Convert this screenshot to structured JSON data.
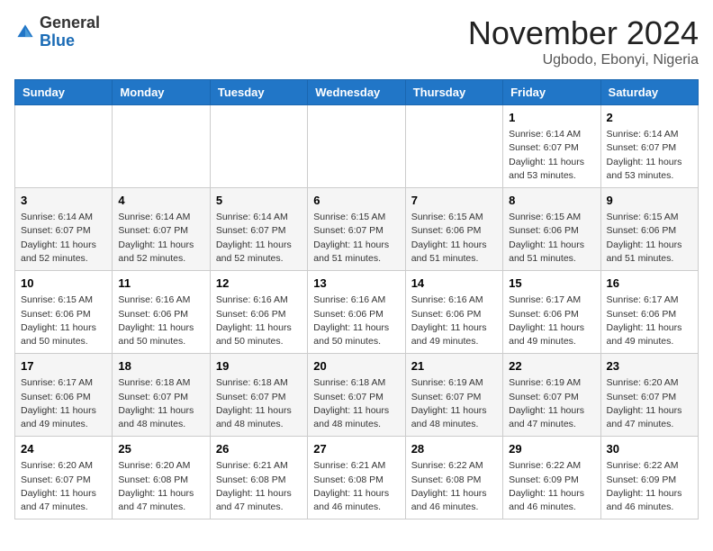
{
  "header": {
    "logo_general": "General",
    "logo_blue": "Blue",
    "month_title": "November 2024",
    "location": "Ugbodo, Ebonyi, Nigeria"
  },
  "days_of_week": [
    "Sunday",
    "Monday",
    "Tuesday",
    "Wednesday",
    "Thursday",
    "Friday",
    "Saturday"
  ],
  "weeks": [
    [
      {
        "day": "",
        "info": ""
      },
      {
        "day": "",
        "info": ""
      },
      {
        "day": "",
        "info": ""
      },
      {
        "day": "",
        "info": ""
      },
      {
        "day": "",
        "info": ""
      },
      {
        "day": "1",
        "info": "Sunrise: 6:14 AM\nSunset: 6:07 PM\nDaylight: 11 hours\nand 53 minutes."
      },
      {
        "day": "2",
        "info": "Sunrise: 6:14 AM\nSunset: 6:07 PM\nDaylight: 11 hours\nand 53 minutes."
      }
    ],
    [
      {
        "day": "3",
        "info": "Sunrise: 6:14 AM\nSunset: 6:07 PM\nDaylight: 11 hours\nand 52 minutes."
      },
      {
        "day": "4",
        "info": "Sunrise: 6:14 AM\nSunset: 6:07 PM\nDaylight: 11 hours\nand 52 minutes."
      },
      {
        "day": "5",
        "info": "Sunrise: 6:14 AM\nSunset: 6:07 PM\nDaylight: 11 hours\nand 52 minutes."
      },
      {
        "day": "6",
        "info": "Sunrise: 6:15 AM\nSunset: 6:07 PM\nDaylight: 11 hours\nand 51 minutes."
      },
      {
        "day": "7",
        "info": "Sunrise: 6:15 AM\nSunset: 6:06 PM\nDaylight: 11 hours\nand 51 minutes."
      },
      {
        "day": "8",
        "info": "Sunrise: 6:15 AM\nSunset: 6:06 PM\nDaylight: 11 hours\nand 51 minutes."
      },
      {
        "day": "9",
        "info": "Sunrise: 6:15 AM\nSunset: 6:06 PM\nDaylight: 11 hours\nand 51 minutes."
      }
    ],
    [
      {
        "day": "10",
        "info": "Sunrise: 6:15 AM\nSunset: 6:06 PM\nDaylight: 11 hours\nand 50 minutes."
      },
      {
        "day": "11",
        "info": "Sunrise: 6:16 AM\nSunset: 6:06 PM\nDaylight: 11 hours\nand 50 minutes."
      },
      {
        "day": "12",
        "info": "Sunrise: 6:16 AM\nSunset: 6:06 PM\nDaylight: 11 hours\nand 50 minutes."
      },
      {
        "day": "13",
        "info": "Sunrise: 6:16 AM\nSunset: 6:06 PM\nDaylight: 11 hours\nand 50 minutes."
      },
      {
        "day": "14",
        "info": "Sunrise: 6:16 AM\nSunset: 6:06 PM\nDaylight: 11 hours\nand 49 minutes."
      },
      {
        "day": "15",
        "info": "Sunrise: 6:17 AM\nSunset: 6:06 PM\nDaylight: 11 hours\nand 49 minutes."
      },
      {
        "day": "16",
        "info": "Sunrise: 6:17 AM\nSunset: 6:06 PM\nDaylight: 11 hours\nand 49 minutes."
      }
    ],
    [
      {
        "day": "17",
        "info": "Sunrise: 6:17 AM\nSunset: 6:06 PM\nDaylight: 11 hours\nand 49 minutes."
      },
      {
        "day": "18",
        "info": "Sunrise: 6:18 AM\nSunset: 6:07 PM\nDaylight: 11 hours\nand 48 minutes."
      },
      {
        "day": "19",
        "info": "Sunrise: 6:18 AM\nSunset: 6:07 PM\nDaylight: 11 hours\nand 48 minutes."
      },
      {
        "day": "20",
        "info": "Sunrise: 6:18 AM\nSunset: 6:07 PM\nDaylight: 11 hours\nand 48 minutes."
      },
      {
        "day": "21",
        "info": "Sunrise: 6:19 AM\nSunset: 6:07 PM\nDaylight: 11 hours\nand 48 minutes."
      },
      {
        "day": "22",
        "info": "Sunrise: 6:19 AM\nSunset: 6:07 PM\nDaylight: 11 hours\nand 47 minutes."
      },
      {
        "day": "23",
        "info": "Sunrise: 6:20 AM\nSunset: 6:07 PM\nDaylight: 11 hours\nand 47 minutes."
      }
    ],
    [
      {
        "day": "24",
        "info": "Sunrise: 6:20 AM\nSunset: 6:07 PM\nDaylight: 11 hours\nand 47 minutes."
      },
      {
        "day": "25",
        "info": "Sunrise: 6:20 AM\nSunset: 6:08 PM\nDaylight: 11 hours\nand 47 minutes."
      },
      {
        "day": "26",
        "info": "Sunrise: 6:21 AM\nSunset: 6:08 PM\nDaylight: 11 hours\nand 47 minutes."
      },
      {
        "day": "27",
        "info": "Sunrise: 6:21 AM\nSunset: 6:08 PM\nDaylight: 11 hours\nand 46 minutes."
      },
      {
        "day": "28",
        "info": "Sunrise: 6:22 AM\nSunset: 6:08 PM\nDaylight: 11 hours\nand 46 minutes."
      },
      {
        "day": "29",
        "info": "Sunrise: 6:22 AM\nSunset: 6:09 PM\nDaylight: 11 hours\nand 46 minutes."
      },
      {
        "day": "30",
        "info": "Sunrise: 6:22 AM\nSunset: 6:09 PM\nDaylight: 11 hours\nand 46 minutes."
      }
    ]
  ]
}
